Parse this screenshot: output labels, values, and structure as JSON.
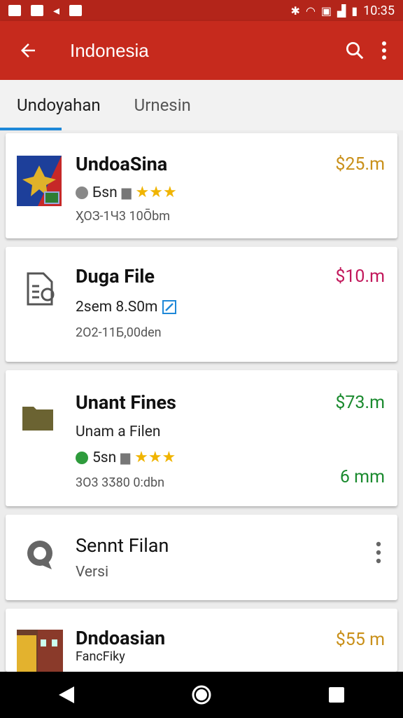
{
  "status": {
    "time": "10:35"
  },
  "appbar": {
    "title": "Indonesia"
  },
  "tabs": [
    {
      "label": "Undoyahan"
    },
    {
      "label": "Urnesin"
    }
  ],
  "items": [
    {
      "name": "UndoaSina",
      "price": "$25.m",
      "price_color": "#c9901a",
      "sub": "Бsn",
      "meta": "ӼОЗ-1Ч3 10Ōbm"
    },
    {
      "name": "Duga File",
      "price": "$10.m",
      "price_color": "#c2185b",
      "sub": "2sem 8.S0m",
      "meta": "2О2-11Б,00den"
    },
    {
      "name": "Unant Fines",
      "price": "$73.m",
      "price_color": "#1a8a2e",
      "sub": "Unam a Filen",
      "sub2": "5sn",
      "meta": "3О3 3Ӡ80 0:dbn",
      "extra": "6 mm"
    },
    {
      "name": "Sennt Filan",
      "sub": "Versi"
    },
    {
      "name": "Dndoasian",
      "price": "$55 m",
      "price_color": "#c9901a",
      "sub": "FancFiky"
    }
  ]
}
